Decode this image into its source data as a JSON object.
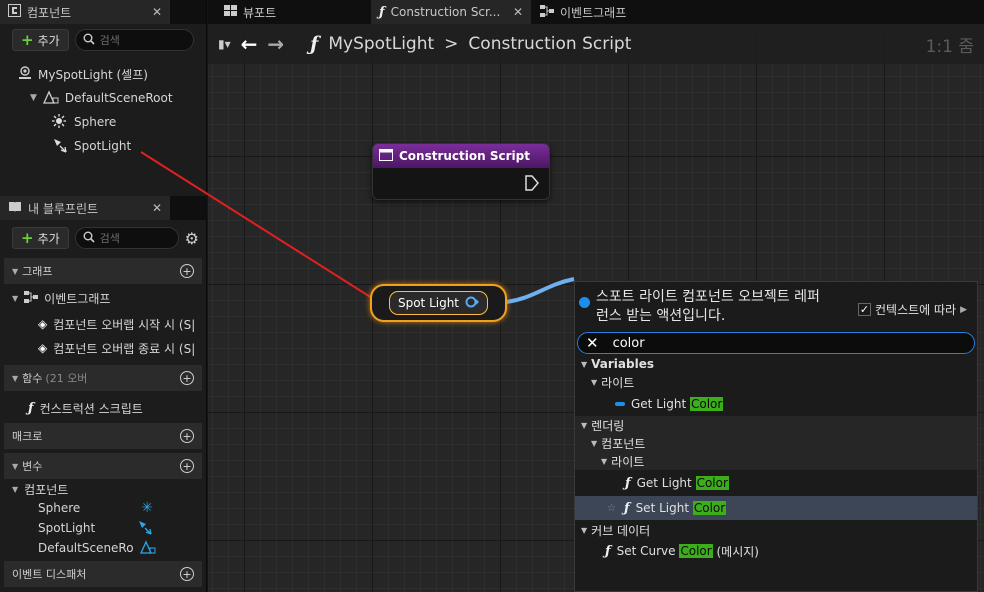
{
  "tabs": {
    "components": "컴포넌트",
    "viewport": "뷰포트",
    "construction": "Construction Scr...",
    "event_graph": "이벤트그래프"
  },
  "components_panel": {
    "add_label": "추가",
    "search_placeholder": "검색",
    "tree": [
      {
        "label": "MySpotLight (셀프)"
      },
      {
        "label": "DefaultSceneRoot"
      },
      {
        "label": "Sphere"
      },
      {
        "label": "SpotLight"
      }
    ]
  },
  "blueprint_panel": {
    "title": "내 블루프린트",
    "add_label": "추가",
    "search_placeholder": "검색",
    "graph_section": "그래프",
    "event_graph": "이벤트그래프",
    "event_items": [
      "컴포넌트 오버랩 시작 시 (S|",
      "컴포넌트 오버랩 종료 시 (S|"
    ],
    "functions_section": "함수",
    "functions_count": "(21 오버",
    "construction_script": "컨스트럭션 스크립트",
    "macros_section": "매크로",
    "variables_section": "변수",
    "components_group": "컴포넌트",
    "variables": [
      "Sphere",
      "SpotLight",
      "DefaultSceneRo"
    ],
    "dispatchers_section": "이벤트 디스패처"
  },
  "graph": {
    "breadcrumb_root": "MySpotLight",
    "breadcrumb_sep": ">",
    "breadcrumb_current": "Construction Script",
    "zoom": "1:1 줌",
    "node_construction": "Construction Script",
    "node_spotlight": "Spot Light"
  },
  "action_menu": {
    "header": "스포트 라이트 컴포넌트 오브젝트 레퍼런스 받는 액션입니다.",
    "context_sensitive": "컨텍스트에 따라",
    "context_checked": true,
    "search_value": "color",
    "highlight": "Color",
    "rows": {
      "variables": "Variables",
      "light1": "라이트",
      "get_light_prefix": "Get Light ",
      "rendering": "렌더링",
      "components": "컴포넌트",
      "light2": "라이트",
      "get_light2_prefix": "Get Light ",
      "set_light_prefix": "Set Light ",
      "curve_data": "커브 데이터",
      "set_curve_prefix": "Set Curve ",
      "set_curve_suffix": " (메시지)"
    }
  },
  "colors": {
    "accent_green": "#3dae1b",
    "node_outline": "#f0a020",
    "function_header": "#7a2d9a",
    "wire_red": "#e02020",
    "wire_blue": "#6fb0f0"
  }
}
